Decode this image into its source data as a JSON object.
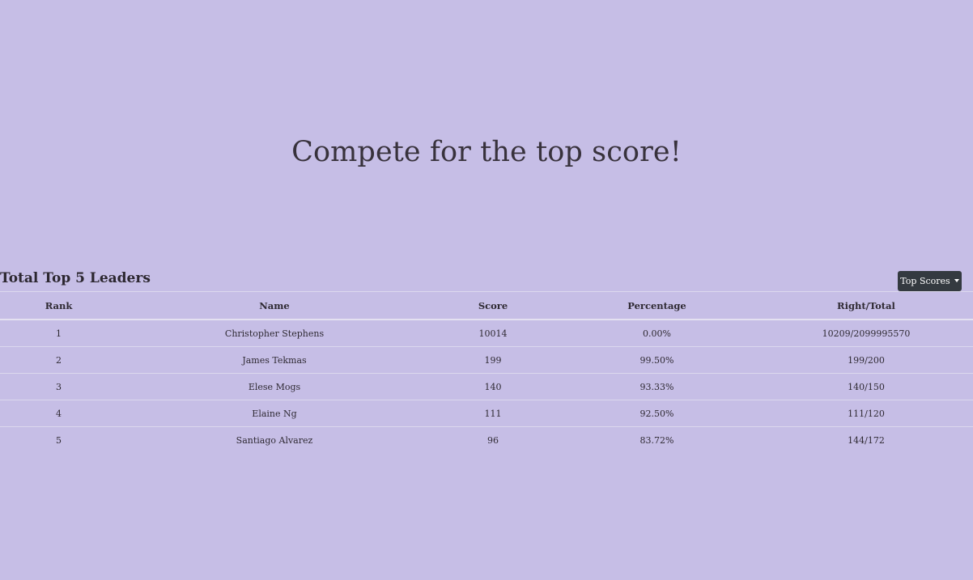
{
  "hero": {
    "title": "Compete for the top score!"
  },
  "leaders": {
    "title": "Total Top 5 Leaders",
    "dropdown_label": "Top Scores",
    "columns": [
      "Rank",
      "Name",
      "Score",
      "Percentage",
      "Right/Total"
    ],
    "rows": [
      {
        "rank": "1",
        "name": "Christopher Stephens",
        "score": "10014",
        "percentage": "0.00%",
        "right_total": "10209/2099995570"
      },
      {
        "rank": "2",
        "name": "James Tekmas",
        "score": "199",
        "percentage": "99.50%",
        "right_total": "199/200"
      },
      {
        "rank": "3",
        "name": "Elese Mogs",
        "score": "140",
        "percentage": "93.33%",
        "right_total": "140/150"
      },
      {
        "rank": "4",
        "name": "Elaine Ng",
        "score": "111",
        "percentage": "92.50%",
        "right_total": "111/120"
      },
      {
        "rank": "5",
        "name": "Santiago Alvarez",
        "score": "96",
        "percentage": "83.72%",
        "right_total": "144/172"
      }
    ]
  },
  "colors": {
    "background": "#c6bee6",
    "button": "#343a40",
    "text": "#2f2a33"
  },
  "icons": {
    "dropdown": "caret-down-icon"
  }
}
